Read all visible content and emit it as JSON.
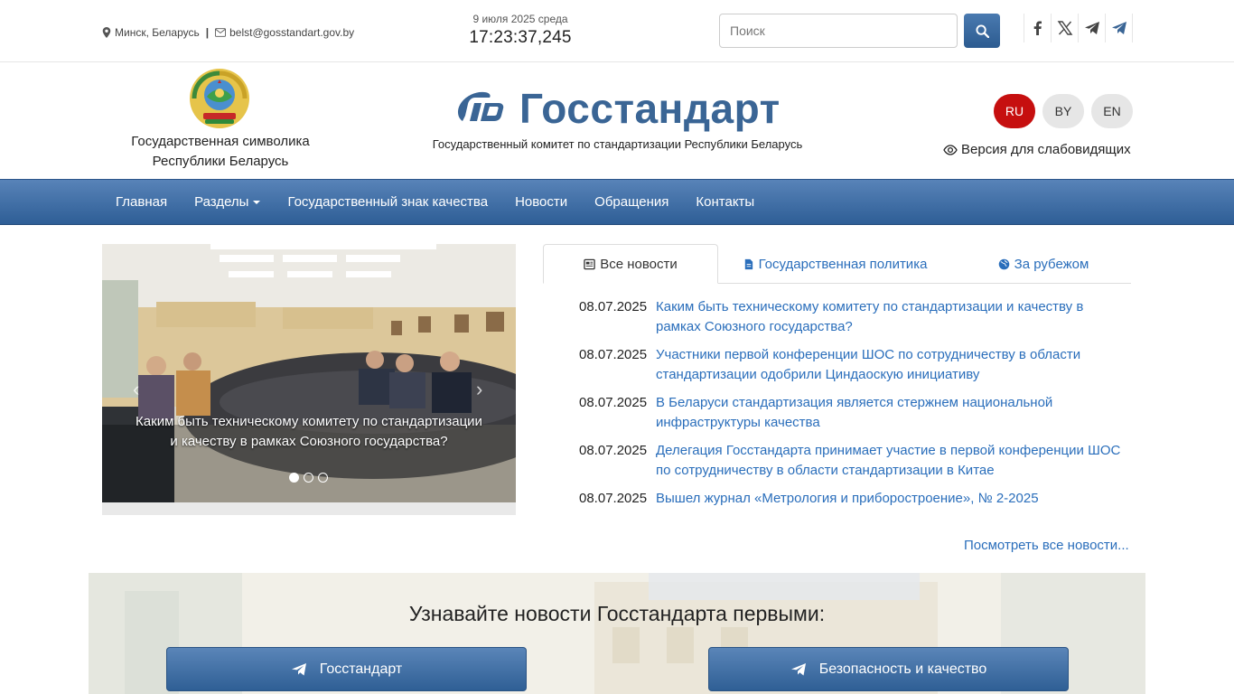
{
  "topbar": {
    "location": "Минск, Беларусь",
    "separator": "|",
    "email": "belst@gosstandart.gov.by",
    "date": "9 июля 2025 среда",
    "time": "17:23:37,245",
    "search_placeholder": "Поиск",
    "socials": [
      "facebook-icon",
      "x-icon",
      "telegram-icon",
      "telegram-icon"
    ]
  },
  "header": {
    "emblem_caption_line1": "Государственная символика",
    "emblem_caption_line2": "Республики Беларусь",
    "brand": "Госстандарт",
    "brand_sub": "Государственный комитет по стандартизации Республики Беларусь",
    "languages": [
      "RU",
      "BY",
      "EN"
    ],
    "active_language": "RU",
    "low_vision": "Версия для слабовидящих"
  },
  "nav": {
    "items": [
      "Главная",
      "Разделы",
      "Государственный знак качества",
      "Новости",
      "Обращения",
      "Контакты"
    ]
  },
  "carousel": {
    "caption": "Каким быть техническому комитету по стандартизации и качеству в рамках Союзного государства?",
    "slides": 3,
    "active_slide": 1,
    "prev": "‹",
    "next": "›"
  },
  "tabs": [
    {
      "label": "Все новости",
      "icon": "newspaper-icon",
      "active": true
    },
    {
      "label": "Государственная политика",
      "icon": "document-icon",
      "active": false
    },
    {
      "label": "За рубежом",
      "icon": "globe-icon",
      "active": false
    }
  ],
  "news": [
    {
      "date": "08.07.2025",
      "title": "Каким быть техническому комитету по стандартизации и качеству в рамках Союзного государства?"
    },
    {
      "date": "08.07.2025",
      "title": "Участники первой конференции ШОС по сотрудничеству в области стандартизации одобрили Циндаоскую инициативу"
    },
    {
      "date": "08.07.2025",
      "title": "В Беларуси стандартизация является стержнем национальной инфраструктуры качества"
    },
    {
      "date": "08.07.2025",
      "title": "Делегация Госстандарта принимает участие в первой конференции ШОС по сотрудничеству в области стандартизации в Китае"
    },
    {
      "date": "08.07.2025",
      "title": "Вышел журнал «Метрология и приборостроение», № 2-2025"
    }
  ],
  "all_news": "Посмотреть все новости...",
  "subscribe": {
    "title": "Узнавайте новости Госстандарта первыми:",
    "buttons": [
      "Госстандарт",
      "Безопасность и качество"
    ]
  },
  "colors": {
    "brand_blue": "#3a6595",
    "link": "#2a6ebb",
    "active_lang": "#c60f0f",
    "nav_top": "#5883b8",
    "nav_bottom": "#2e5e96"
  }
}
